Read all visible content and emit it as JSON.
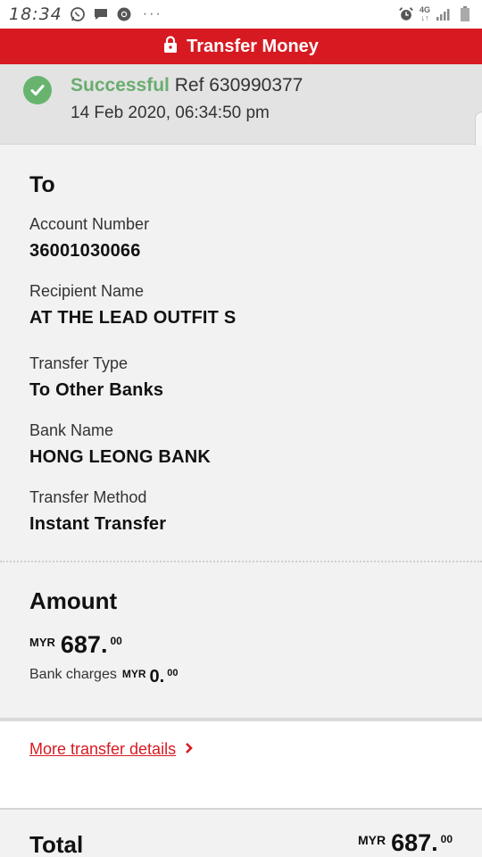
{
  "status_bar": {
    "time": "18:34",
    "icons_left": [
      "whatsapp-icon",
      "message-icon",
      "chrome-icon"
    ],
    "overflow": "···",
    "network": "4G",
    "icons_right": [
      "alarm-icon",
      "signal-icon",
      "battery-icon"
    ]
  },
  "header": {
    "title": "Transfer Money",
    "icon": "lock-icon",
    "color": "#d71a21"
  },
  "status": {
    "result": "Successful",
    "ref": "Ref 630990377",
    "datetime": "14 Feb 2020, 06:34:50 pm",
    "color": "#6aac70"
  },
  "recipient": {
    "section_title": "To",
    "fields": [
      {
        "label": "Account Number",
        "value": "36001030066"
      },
      {
        "label": "Recipient Name",
        "value": "AT THE LEAD OUTFIT S"
      },
      {
        "label": "Transfer Type",
        "value": "To Other Banks"
      },
      {
        "label": "Bank Name",
        "value": "HONG LEONG BANK"
      },
      {
        "label": "Transfer Method",
        "value": "Instant Transfer"
      }
    ]
  },
  "amount": {
    "section_title": "Amount",
    "currency": "MYR",
    "main": "687.",
    "cents": "00",
    "charges_label": "Bank charges",
    "charges_currency": "MYR",
    "charges_main": "0.",
    "charges_cents": "00"
  },
  "more_link": {
    "label": "More transfer details"
  },
  "total": {
    "label": "Total",
    "currency": "MYR",
    "main": "687.",
    "cents": "00"
  }
}
